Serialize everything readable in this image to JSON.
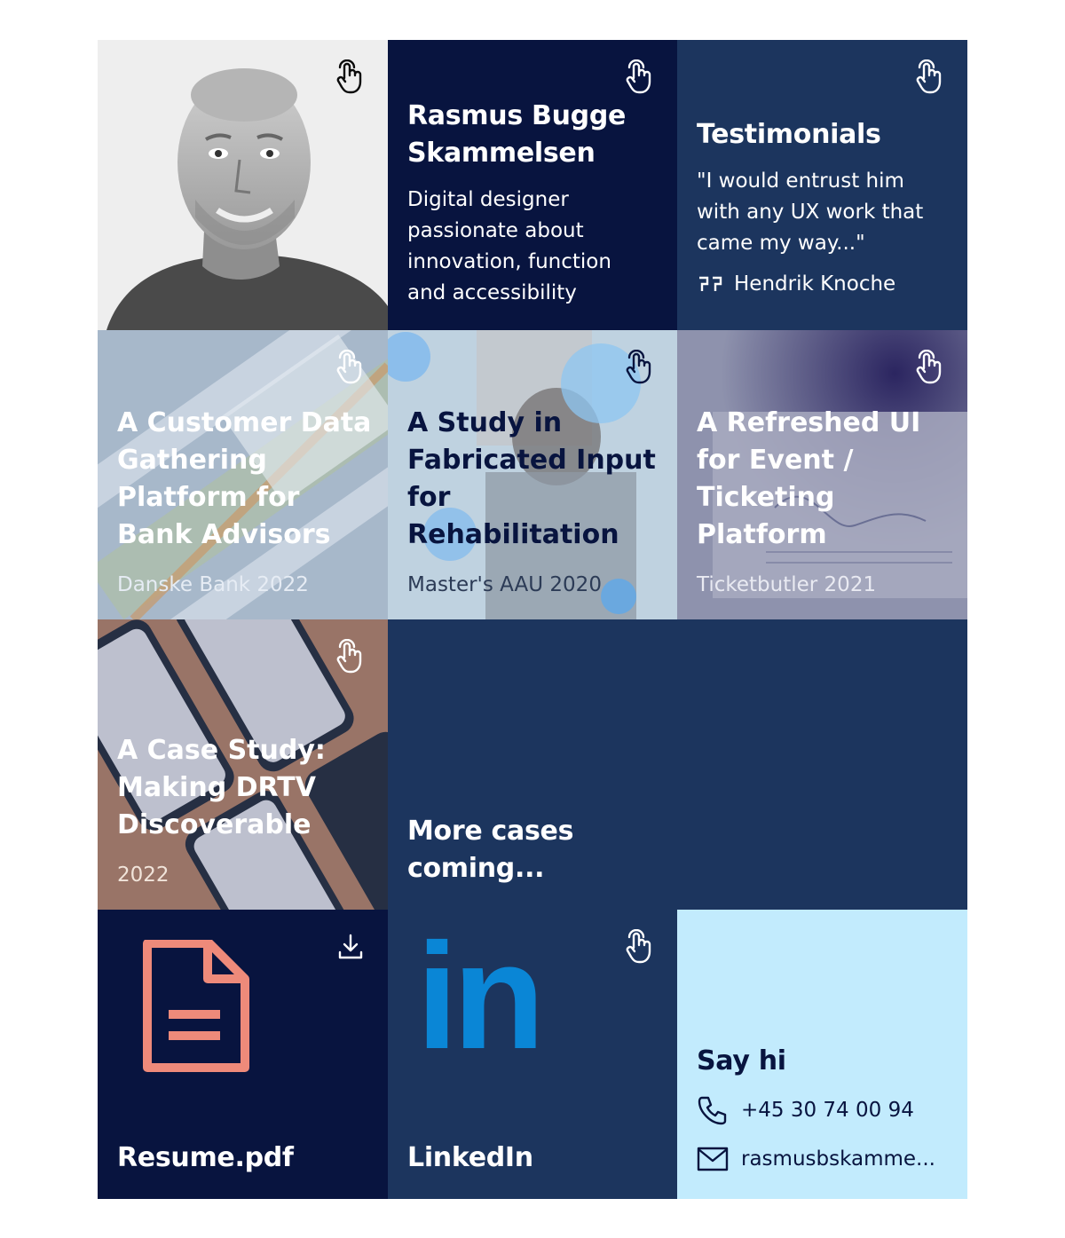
{
  "intro": {
    "name": "Rasmus Bugge Skammelsen",
    "tagline": "Digital designer passionate about innovation, function and accessibility"
  },
  "testimonials": {
    "title": "Testimonials",
    "quote": "\"I would entrust him with any UX work that came my way...\"",
    "author": "Hendrik Knoche"
  },
  "cases": [
    {
      "title": "A Customer Data Gathering Platform for Bank Advisors",
      "subtitle": "Danske Bank 2022"
    },
    {
      "title": "A Study in Fabricated Input for Rehabilitation",
      "subtitle": "Master's AAU 2020"
    },
    {
      "title": "A Refreshed UI for Event / Ticketing Platform",
      "subtitle": "Ticketbutler 2021"
    },
    {
      "title": "A Case Study: Making DRTV Discoverable",
      "subtitle": "2022"
    }
  ],
  "more_cases": {
    "label": "More cases coming..."
  },
  "resume": {
    "label": "Resume.pdf"
  },
  "linkedin": {
    "label": "LinkedIn",
    "logo_text": "in"
  },
  "contact": {
    "title": "Say hi",
    "phone": "+45 30 74 00 94",
    "email": "rasmusbskamme..."
  },
  "colors": {
    "navy": "#08143f",
    "blue": "#1c355e",
    "light": "#c2ebfd",
    "resume_icon": "#ee8a7a",
    "linkedin": "#0a86d6"
  },
  "icons": {
    "tap": "hand-pointer-icon",
    "download": "download-icon",
    "quote": "quote-icon",
    "phone": "phone-icon",
    "mail": "mail-icon",
    "document": "document-icon"
  }
}
